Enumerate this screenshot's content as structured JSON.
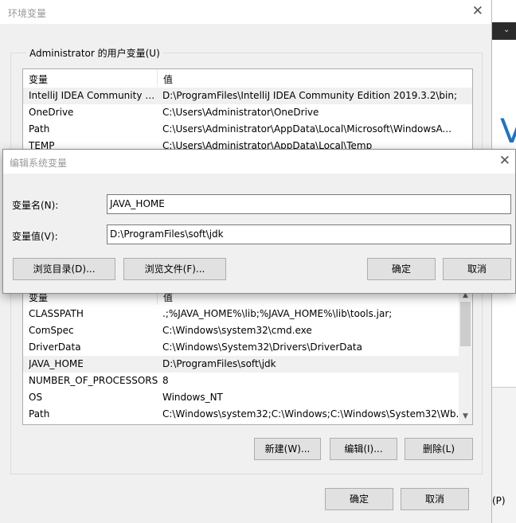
{
  "env_dialog": {
    "title": "环境变量",
    "close_glyph": "✕",
    "user_group": {
      "legend": "Administrator 的用户变量(U)",
      "col_name": "变量",
      "col_value": "值",
      "rows": [
        {
          "name": "IntelliJ IDEA Community E...",
          "value": "D:\\ProgramFiles\\IntelliJ IDEA Community Edition 2019.3.2\\bin;"
        },
        {
          "name": "OneDrive",
          "value": "C:\\Users\\Administrator\\OneDrive"
        },
        {
          "name": "Path",
          "value": "C:\\Users\\Administrator\\AppData\\Local\\Microsoft\\WindowsA..."
        },
        {
          "name": "TEMP",
          "value": "C:\\Users\\Administrator\\AppData\\Local\\Temp"
        }
      ]
    },
    "system_group": {
      "col_name": "变量",
      "col_value": "值",
      "rows": [
        {
          "name": "CLASSPATH",
          "value": ".;%JAVA_HOME%\\lib;%JAVA_HOME%\\lib\\tools.jar;"
        },
        {
          "name": "ComSpec",
          "value": "C:\\Windows\\system32\\cmd.exe"
        },
        {
          "name": "DriverData",
          "value": "C:\\Windows\\System32\\Drivers\\DriverData"
        },
        {
          "name": "JAVA_HOME",
          "value": "D:\\ProgramFiles\\soft\\jdk"
        },
        {
          "name": "NUMBER_OF_PROCESSORS",
          "value": "8"
        },
        {
          "name": "OS",
          "value": "Windows_NT"
        },
        {
          "name": "Path",
          "value": "C:\\Windows\\system32;C:\\Windows;C:\\Windows\\System32\\Wb..."
        }
      ],
      "new_button": "新建(W)...",
      "edit_button": "编辑(I)...",
      "delete_button": "删除(L)"
    },
    "ok_button": "确定",
    "cancel_button": "取消"
  },
  "edit_dialog": {
    "title": "编辑系统变量",
    "close_glyph": "✕",
    "name_label": "变量名(N):",
    "name_value": "JAVA_HOME",
    "value_label": "变量值(V):",
    "value_value": "D:\\ProgramFiles\\soft\\jdk",
    "browse_dir_button": "浏览目录(D)...",
    "browse_file_button": "浏览文件(F)...",
    "ok_button": "确定",
    "cancel_button": "取消"
  },
  "background_app": {
    "big_letter": "V",
    "partial_text": "(P)",
    "menu_glyph": "⌄"
  },
  "icons": {
    "scroll_up": "scroll-up-arrow-icon",
    "scroll_down": "scroll-down-arrow-icon",
    "close": "close-icon"
  }
}
